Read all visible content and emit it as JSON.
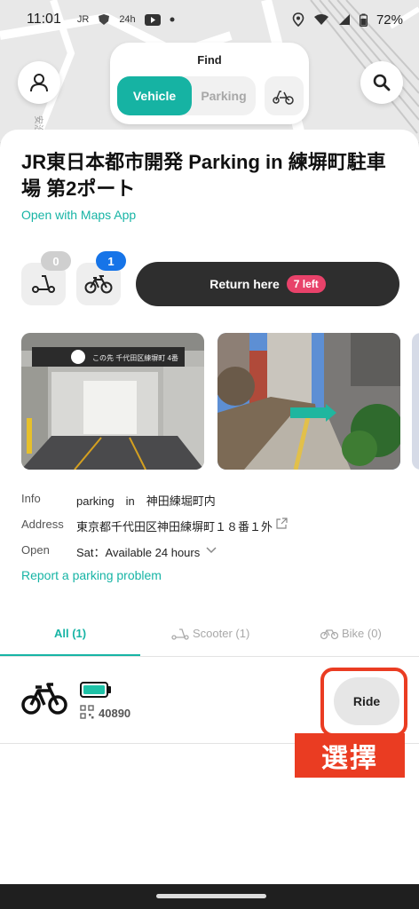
{
  "status_bar": {
    "time": "11:01",
    "notifications": [
      "JR",
      "24h"
    ],
    "battery_pct": "72%"
  },
  "find": {
    "title": "Find",
    "vehicle_label": "Vehicle",
    "parking_label": "Parking"
  },
  "station": {
    "title": "JR東日本都市開発 Parking in 練塀町駐車場 第2ポート",
    "maps_link": "Open with Maps App",
    "scooter_count": "0",
    "bike_count": "1",
    "return_label": "Return here",
    "slots_left": "7 left",
    "photo_sign_text": "この先 千代田区練塀町 4番"
  },
  "info": {
    "info_label": "Info",
    "info_value": "parking　in　神田練堀町内",
    "address_label": "Address",
    "address_value": "東京都千代田区神田練塀町１８番１外",
    "open_label": "Open",
    "open_value": "Sat：Available 24 hours",
    "report_link": "Report a parking problem"
  },
  "tabs": {
    "all": "All (1)",
    "scooter": "Scooter (1)",
    "bike": "Bike (0)"
  },
  "vehicle": {
    "id": "40890",
    "ride_label": "Ride",
    "battery_level": 1.0
  },
  "annotation": {
    "label": "選擇"
  },
  "colors": {
    "accent": "#16b3a3",
    "badge_blue": "#1674e8",
    "pill_red": "#e8426a",
    "annotation_red": "#ea3c22"
  }
}
